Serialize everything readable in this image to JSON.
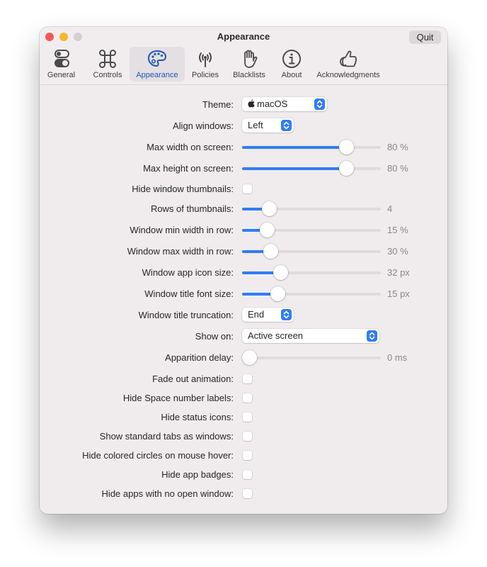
{
  "window": {
    "title": "Appearance",
    "quit_label": "Quit"
  },
  "toolbar": {
    "tabs": [
      {
        "label": "General",
        "icon": "toggles-icon",
        "active": false
      },
      {
        "label": "Controls",
        "icon": "command-icon",
        "active": false
      },
      {
        "label": "Appearance",
        "icon": "palette-icon",
        "active": true
      },
      {
        "label": "Policies",
        "icon": "antenna-icon",
        "active": false
      },
      {
        "label": "Blacklists",
        "icon": "hand-icon",
        "active": false
      },
      {
        "label": "About",
        "icon": "info-icon",
        "active": false
      },
      {
        "label": "Acknowledgments",
        "icon": "thumbs-up-icon",
        "active": false
      }
    ]
  },
  "colors": {
    "accent": "#2f7cf6",
    "active_tab_text": "#1e57b8"
  },
  "settings": [
    {
      "label": "Theme:",
      "type": "popup",
      "value": "macOS",
      "icon": "apple-icon"
    },
    {
      "label": "Align windows:",
      "type": "popup",
      "value": "Left"
    },
    {
      "label": "Max width on screen:",
      "type": "slider",
      "fraction": 0.78,
      "value_text": "80 %"
    },
    {
      "label": "Max height on screen:",
      "type": "slider",
      "fraction": 0.78,
      "value_text": "80 %"
    },
    {
      "label": "Hide window thumbnails:",
      "type": "checkbox",
      "checked": false
    },
    {
      "label": "Rows of thumbnails:",
      "type": "slider",
      "fraction": 0.16,
      "value_text": "4"
    },
    {
      "label": "Window min width in row:",
      "type": "slider",
      "fraction": 0.14,
      "value_text": "15 %"
    },
    {
      "label": "Window max width in row:",
      "type": "slider",
      "fraction": 0.17,
      "value_text": "30 %"
    },
    {
      "label": "Window app icon size:",
      "type": "slider",
      "fraction": 0.25,
      "value_text": "32 px"
    },
    {
      "label": "Window title font size:",
      "type": "slider",
      "fraction": 0.23,
      "value_text": "15 px"
    },
    {
      "label": "Window title truncation:",
      "type": "popup",
      "value": "End"
    },
    {
      "label": "Show on:",
      "type": "popup",
      "value": "Active screen"
    },
    {
      "label": "Apparition delay:",
      "type": "slider",
      "fraction": 0.0,
      "value_text": "0 ms"
    },
    {
      "label": "Fade out animation:",
      "type": "checkbox",
      "checked": false
    },
    {
      "label": "Hide Space number labels:",
      "type": "checkbox",
      "checked": false
    },
    {
      "label": "Hide status icons:",
      "type": "checkbox",
      "checked": false
    },
    {
      "label": "Show standard tabs as windows:",
      "type": "checkbox",
      "checked": false
    },
    {
      "label": "Hide colored circles on mouse hover:",
      "type": "checkbox",
      "checked": false
    },
    {
      "label": "Hide app badges:",
      "type": "checkbox",
      "checked": false
    },
    {
      "label": "Hide apps with no open window:",
      "type": "checkbox",
      "checked": false
    }
  ]
}
